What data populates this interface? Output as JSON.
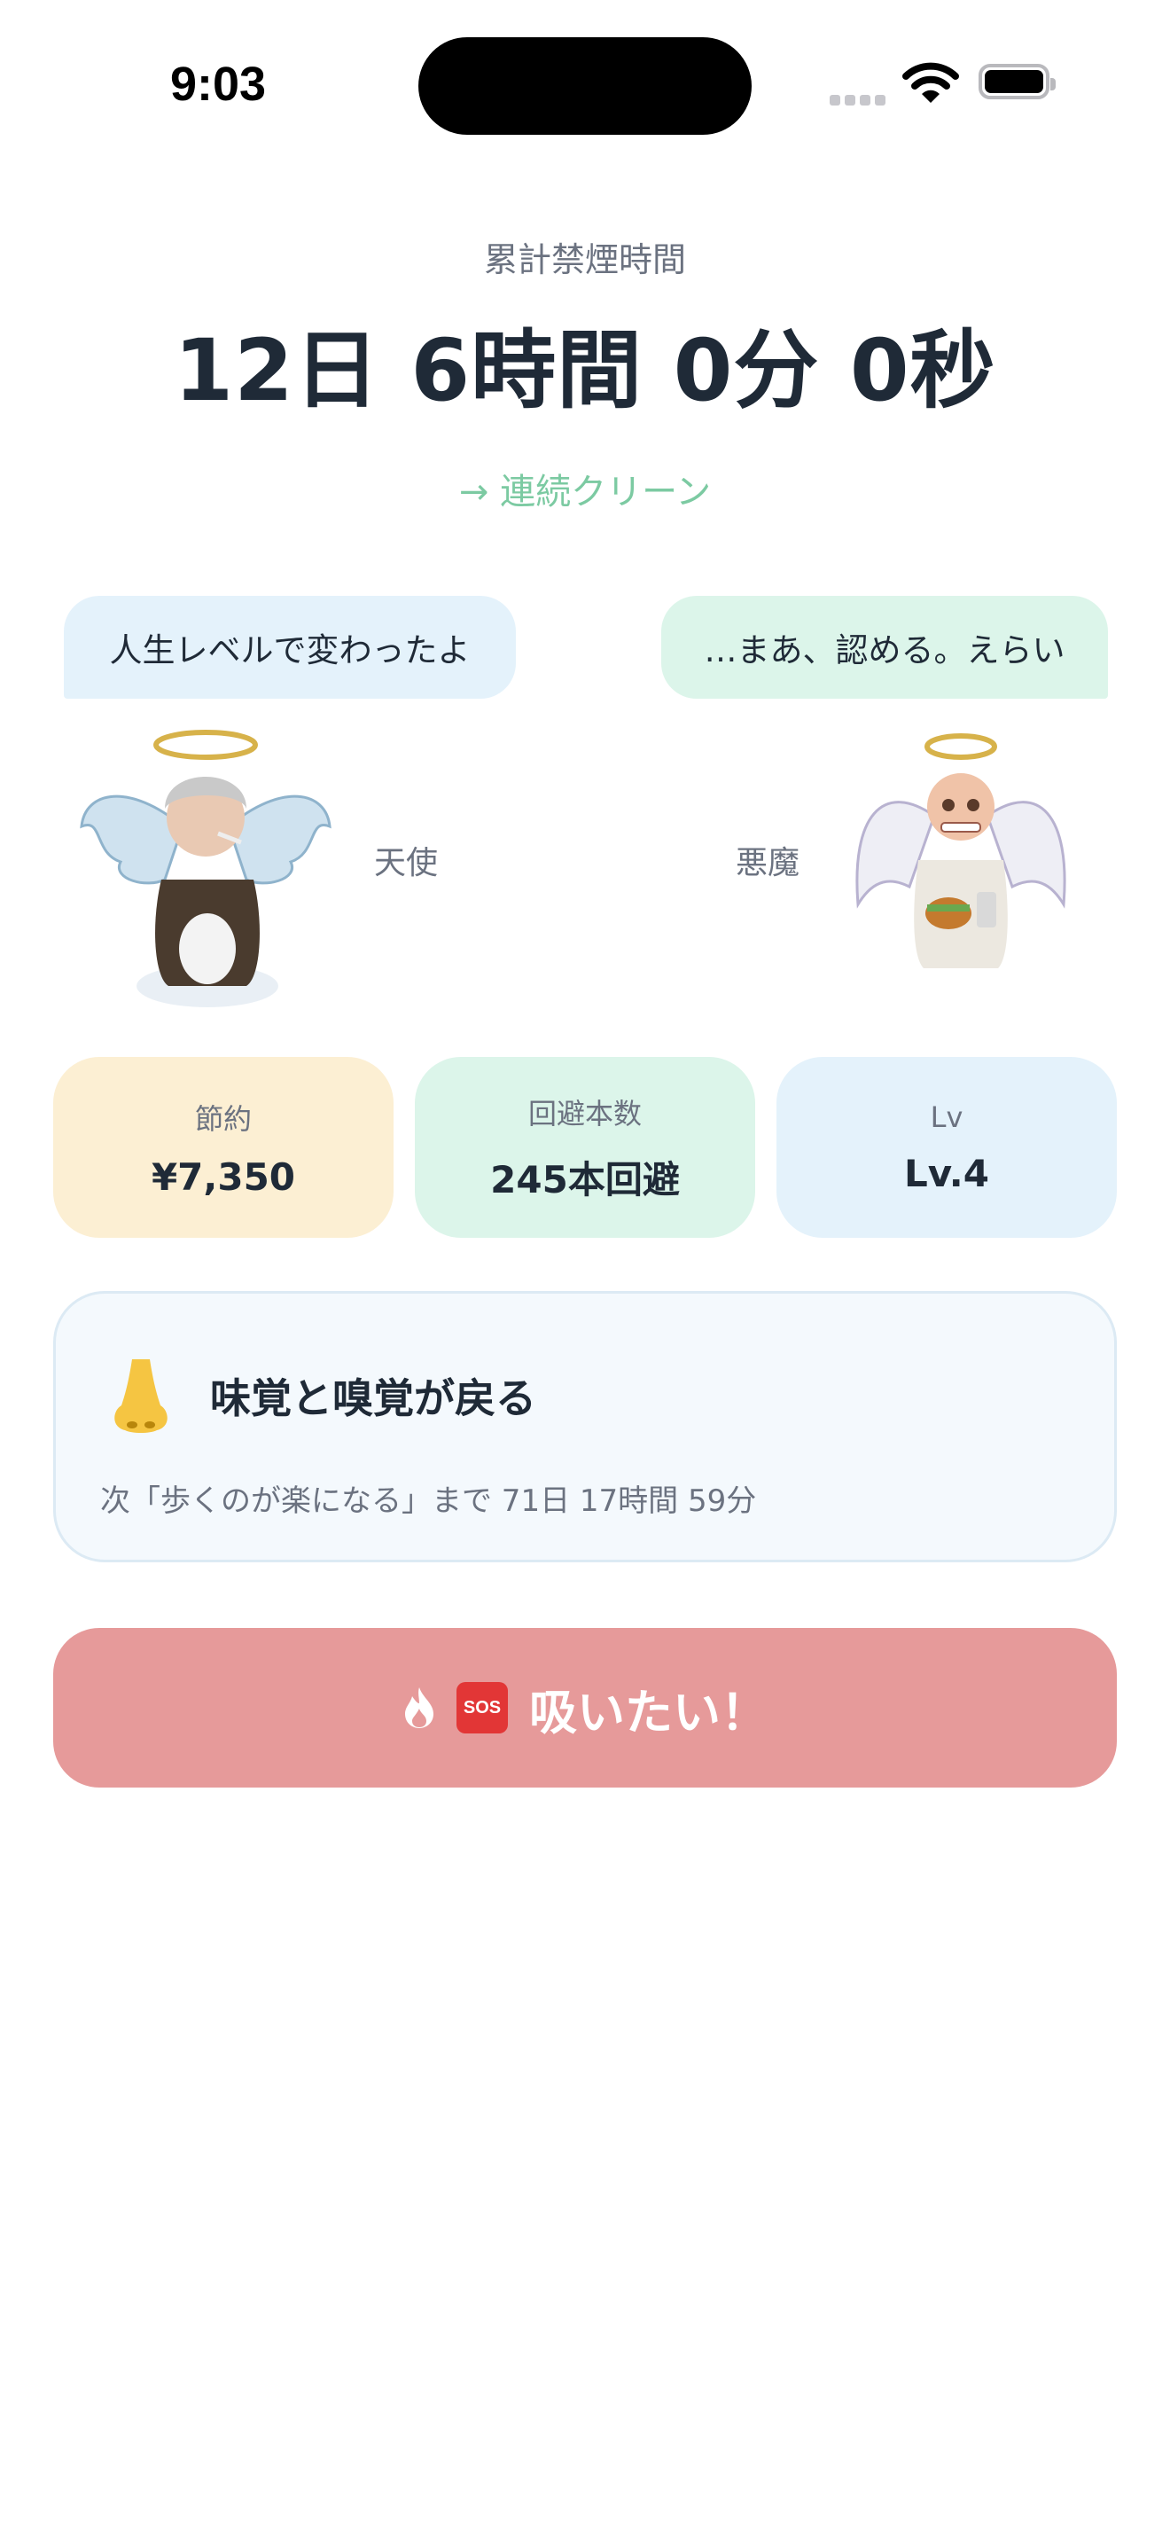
{
  "status_bar": {
    "time": "9:03"
  },
  "header": {
    "cumulative_label": "累計禁煙時間",
    "cumulative_time": "12日 6時間 0分 0秒",
    "streak_link": "→ 連続クリーン"
  },
  "characters": {
    "angel": {
      "speech": "人生レベルで変わったよ",
      "label": "天使"
    },
    "devil": {
      "speech": "…まあ、認める。えらい",
      "label": "悪魔"
    }
  },
  "stats": [
    {
      "label": "節約",
      "value": "¥7,350",
      "color": "#fcefd3"
    },
    {
      "label": "回避本数",
      "value": "245本回避",
      "color": "#dcf5ea"
    },
    {
      "label": "Lv",
      "value": "Lv.4",
      "color": "#e4f2fb"
    }
  ],
  "milestone": {
    "icon": "nose-icon",
    "title": "味覚と嗅覚が戻る",
    "next": "次「歩くのが楽になる」まで 71日 17時間 59分"
  },
  "sos": {
    "label": "吸いたい！",
    "icon_text": "SOS",
    "color": "#e69a9a"
  }
}
